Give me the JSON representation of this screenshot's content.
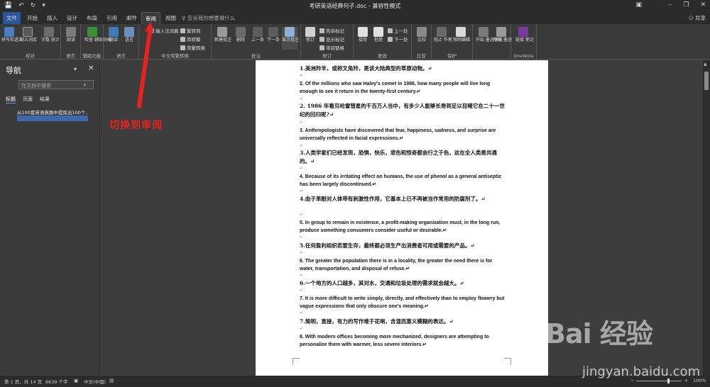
{
  "titlebar": {
    "doc_title": "考研英语经典句子.doc  -  兼容性模式",
    "qa_save": "💾",
    "qa_undo": "↶",
    "qa_redo": "↻",
    "qa_more": "▾",
    "minimize": "–",
    "restore": "❐",
    "close": "✕",
    "ribbon_display": "▣"
  },
  "tabs": {
    "items": [
      "文件",
      "开始",
      "插入",
      "设计",
      "布局",
      "引用",
      "邮件",
      "审阅",
      "视图"
    ],
    "active": "审阅",
    "search_placeholder": "♀ 告诉我你想要做什么",
    "share": "⚇ 共享"
  },
  "ribbon": {
    "groups": {
      "proofing": "校对",
      "language_g": "语言",
      "accessibility": "辅助功能",
      "chinese_convert": "中文简繁转换",
      "comments": "批注",
      "tracking": "修订",
      "changes": "更改",
      "compare": "比较",
      "protect": "保护",
      "onenote": "OneNote"
    },
    "buttons": {
      "spelling": "拼写和语法",
      "thesaurus": "同义词库",
      "word_count": "字数\n统计",
      "smart_lookup": "朗读",
      "check_access": "检查\n辅助功能",
      "translate": "翻译",
      "language": "语言",
      "new_comment": "新建批注",
      "delete": "删除",
      "previous": "上一条",
      "next": "下一条",
      "show_comments": "显示批注",
      "track_changes": "修订",
      "accept": "接受",
      "reject": "拒绝",
      "compare": "比较",
      "block_authors": "阻止\n作者",
      "restrict_editing": "限制编辑",
      "start_inking": "开始\n墨迹书写",
      "hide_ink": "隐藏\n墨迹",
      "linked_notes": "链接\n笔记"
    },
    "small": {
      "ime_dict": "输入法词典",
      "to_trad": "繁转简",
      "to_simp": "简转繁",
      "convert": "简繁转换",
      "simple_markup": "简单标记",
      "show_markup": "显示标记",
      "reviewing_pane": "审阅窗格",
      "prev_change": "上一处",
      "next_change": "下一处"
    }
  },
  "nav": {
    "title": "导航",
    "pin": "▾",
    "close": "✕",
    "search_placeholder": "在文档中搜索",
    "search_icon": "⌕",
    "tabs": [
      "标题",
      "页面",
      "结果"
    ],
    "heading_item": "从100套英语真题中提炼出100个..."
  },
  "annotation": {
    "text": "切换到审阅",
    "color": "#e4221f"
  },
  "document": {
    "paragraphs": [
      {
        "type": "cn",
        "text": "1.美洲羚羊，或称叉角羚，是该大陆典型的草原动物。↵"
      },
      {
        "type": "en",
        "text": "2. Of the millions who saw Haley′s comet in 1986, how many people will live long enough to see it return in the twenty-first century.↵"
      },
      {
        "type": "cn",
        "text": "2. 1986 年看见哈雷彗星的千百万人当中，有多少人能够长寿到足以目睹它在二十一世纪的回归呢?↵"
      },
      {
        "type": "en",
        "text": "3. Anthropologists have discovered that fear, happiness, sadness, and surprise are universally reflected in facial expressions.↵"
      },
      {
        "type": "cn",
        "text": "3.人类学家们已经发现，恐惧，快乐，悲伤和惊奇都会行之于色，这在全人类是共通的。↵"
      },
      {
        "type": "en",
        "text": "4. Because of its irritating effect on humans, the use of phenol as a general antiseptic has been largely discontinued.↵"
      },
      {
        "type": "cn",
        "text": "4.由于苯酚对人体带有刺激性作用，它基本上已不再被当作常用的防腐剂了。↵"
      },
      {
        "type": "en",
        "text": "5. In group to remain in existence, a profit-making organization must, in the long run, produce something consumers consider useful or desirable.↵"
      },
      {
        "type": "cn",
        "text": "5.任何盈利组织若要生存，最终都必须生产出消费者可用或需要的产品。↵"
      },
      {
        "type": "en",
        "text": "6. The greater the population there is in a locality, the greater the need there is for water, transportation, and disposal of refuse.↵"
      },
      {
        "type": "cn",
        "text": "6.一个地方的人口越多，其对水，交通和垃圾处理的需求就会越大。↵"
      },
      {
        "type": "en",
        "text": "7. It is more difficult to write simply, directly, and effectively than to employ flowery but vague expressions that only obscure one′s meaning.↵"
      },
      {
        "type": "cn",
        "text": "7.简明，直接，有力的写作难于花哨，含混而意义模糊的表达。↵"
      },
      {
        "type": "en",
        "text": "8. With modern offices becoming more mechanized, designers are attempting to personalize them with warmer, less severe interiors.↵"
      }
    ],
    "para_mark": "↵"
  },
  "status": {
    "page": "第 1 页，共 14 页",
    "words": "6639 个字",
    "proof_icon": "▣",
    "language": "中文(中国)",
    "macro_icon": "▤",
    "zoom_minus": "−",
    "zoom_plus": "+",
    "zoom": "100%"
  },
  "watermark": {
    "logo": "Bai  经验",
    "sub": "jingyan.baidu.com"
  }
}
